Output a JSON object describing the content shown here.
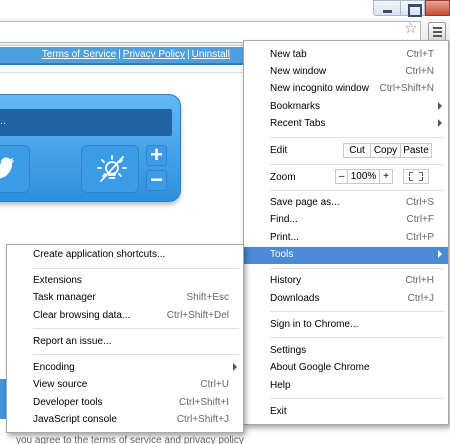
{
  "page": {
    "links": [
      "Terms of Service",
      "Privacy Policy",
      "Uninstall"
    ],
    "search_placeholder": "...",
    "footer": "you agree to the terms of service and privacy policy",
    "colors": {
      "brand_blue": "#4e9fdd",
      "widget_blue": "#3c9be6",
      "highlight": "#4a8ad6"
    }
  },
  "menu": {
    "new_tab": {
      "label": "New tab",
      "shortcut": "Ctrl+T"
    },
    "new_window": {
      "label": "New window",
      "shortcut": "Ctrl+N"
    },
    "new_incognito": {
      "label": "New incognito window",
      "shortcut": "Ctrl+Shift+N"
    },
    "bookmarks": {
      "label": "Bookmarks"
    },
    "recent_tabs": {
      "label": "Recent Tabs"
    },
    "edit": {
      "label": "Edit",
      "cut": "Cut",
      "copy": "Copy",
      "paste": "Paste"
    },
    "zoom": {
      "label": "Zoom",
      "minus": "–",
      "value": "100%",
      "plus": "+"
    },
    "save_page": {
      "label": "Save page as...",
      "shortcut": "Ctrl+S"
    },
    "find": {
      "label": "Find...",
      "shortcut": "Ctrl+F"
    },
    "print": {
      "label": "Print...",
      "shortcut": "Ctrl+P"
    },
    "tools": {
      "label": "Tools"
    },
    "history": {
      "label": "History",
      "shortcut": "Ctrl+H"
    },
    "downloads": {
      "label": "Downloads",
      "shortcut": "Ctrl+J"
    },
    "sign_in": {
      "label": "Sign in to Chrome..."
    },
    "settings": {
      "label": "Settings"
    },
    "about": {
      "label": "About Google Chrome"
    },
    "help": {
      "label": "Help"
    },
    "exit": {
      "label": "Exit"
    }
  },
  "tools_menu": {
    "create_shortcuts": {
      "label": "Create application shortcuts..."
    },
    "extensions": {
      "label": "Extensions"
    },
    "task_manager": {
      "label": "Task manager",
      "shortcut": "Shift+Esc"
    },
    "clear_data": {
      "label": "Clear browsing data...",
      "shortcut": "Ctrl+Shift+Del"
    },
    "report_issue": {
      "label": "Report an issue..."
    },
    "encoding": {
      "label": "Encoding"
    },
    "view_source": {
      "label": "View source",
      "shortcut": "Ctrl+U"
    },
    "dev_tools": {
      "label": "Developer tools",
      "shortcut": "Ctrl+Shift+I"
    },
    "js_console": {
      "label": "JavaScript console",
      "shortcut": "Ctrl+Shift+J"
    }
  }
}
